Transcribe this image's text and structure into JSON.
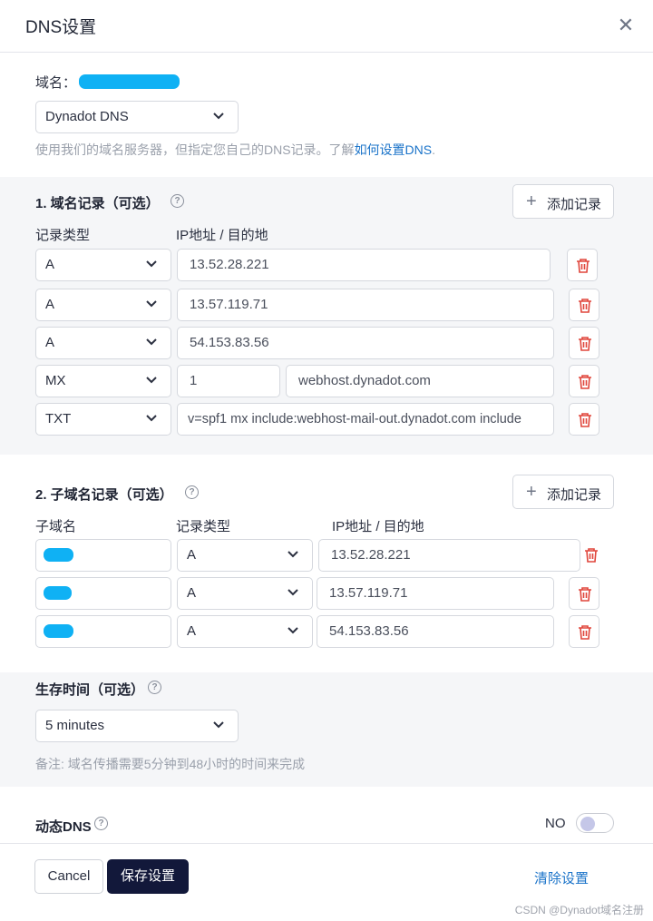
{
  "dialog": {
    "title": "DNS设置",
    "close_icon": "close-icon"
  },
  "domain": {
    "label": "域名：",
    "nameserver_select": "Dynadot DNS",
    "hint_prefix": "使用我们的域名服务器，但指定您自己的DNS记录。了解",
    "hint_link": "如何设置DNS",
    "hint_suffix": "."
  },
  "records": {
    "title": "1. 域名记录（可选）",
    "add_label": "添加记录",
    "col_type": "记录类型",
    "col_target": "IP地址 / 目的地",
    "rows": [
      {
        "type": "A",
        "value": "13.52.28.221"
      },
      {
        "type": "A",
        "value": "13.57.119.71"
      },
      {
        "type": "A",
        "value": "54.153.83.56"
      },
      {
        "type": "MX",
        "priority": "1",
        "value": "webhost.dynadot.com"
      },
      {
        "type": "TXT",
        "value": "v=spf1 mx include:webhost-mail-out.dynadot.com include"
      }
    ]
  },
  "subdomains": {
    "title": "2. 子域名记录（可选）",
    "add_label": "添加记录",
    "col_sub": "子域名",
    "col_type": "记录类型",
    "col_target": "IP地址 / 目的地",
    "rows": [
      {
        "type": "A",
        "value": "13.52.28.221"
      },
      {
        "type": "A",
        "value": "13.57.119.71"
      },
      {
        "type": "A",
        "value": "54.153.83.56"
      }
    ]
  },
  "ttl": {
    "title": "生存时间（可选）",
    "select": "5 minutes",
    "note": "备注: 域名传播需要5分钟到48小时的时间来完成"
  },
  "dynamic_dns": {
    "title": "动态DNS",
    "state": "NO"
  },
  "footer": {
    "cancel": "Cancel",
    "save": "保存设置",
    "clear": "清除设置",
    "watermark": "CSDN @Dynadot域名注册"
  },
  "colors": {
    "accent": "#1a73c9",
    "primary_button": "#12183a",
    "delete": "#e0463c",
    "redacted": "#0fb1f4"
  }
}
